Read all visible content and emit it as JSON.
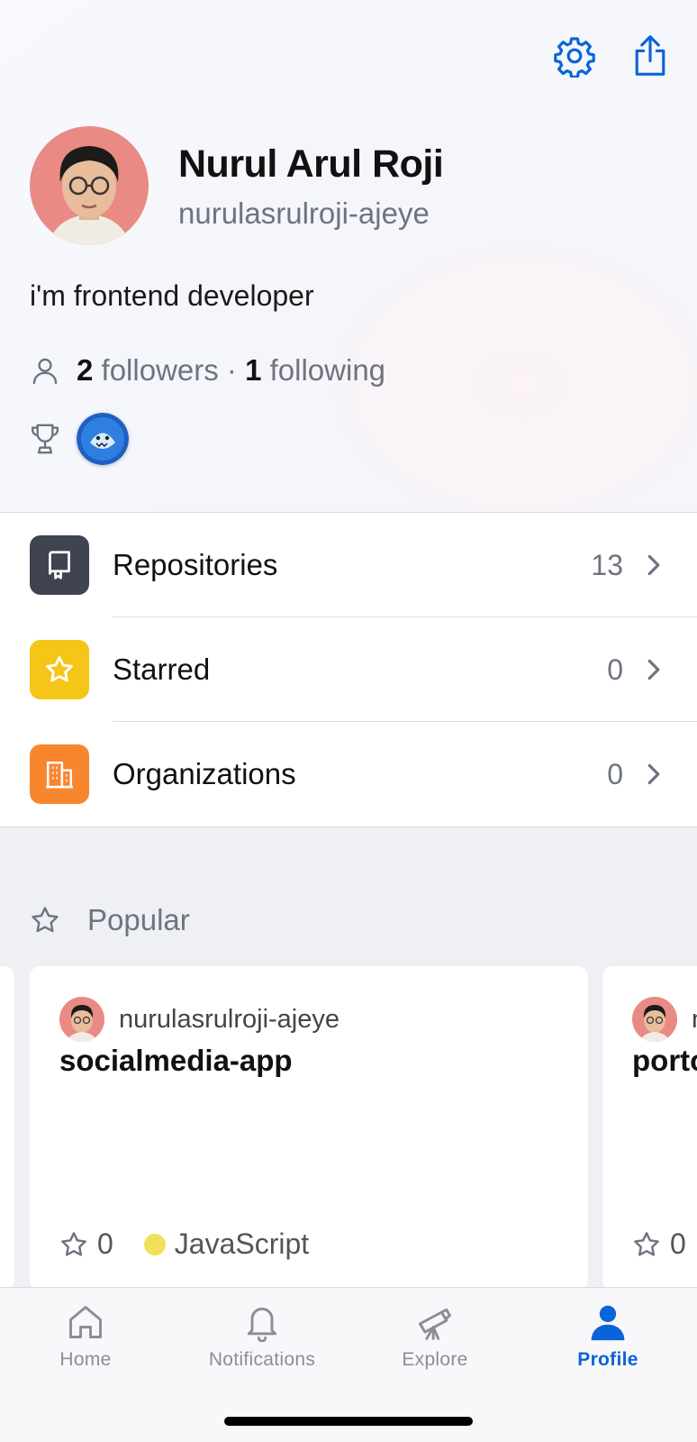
{
  "colors": {
    "accent": "#0a64d9",
    "repo_tile": "#3f4450",
    "starred_tile": "#f5c518",
    "org_tile": "#f7862e",
    "javascript": "#f1e05a"
  },
  "toolbar": {
    "settings_icon": "gear-icon",
    "share_icon": "share-icon"
  },
  "profile": {
    "name": "Nurul Arul Roji",
    "username": "nurulasrulroji-ajeye",
    "bio": "i'm frontend developer",
    "followers_count": "2",
    "followers_label": "followers",
    "separator": "·",
    "following_count": "1",
    "following_label": "following"
  },
  "menu": [
    {
      "label": "Repositories",
      "count": "13",
      "icon": "repo-icon"
    },
    {
      "label": "Starred",
      "count": "0",
      "icon": "star-icon"
    },
    {
      "label": "Organizations",
      "count": "0",
      "icon": "organization-icon"
    }
  ],
  "popular": {
    "title": "Popular",
    "cards": [
      {
        "owner": "nurulasrulroji-ajeye",
        "repo": "socialmedia-app",
        "stars": "0",
        "language": "JavaScript"
      },
      {
        "owner": "n",
        "repo": "porto",
        "stars": "0"
      }
    ]
  },
  "tabs": [
    {
      "label": "Home",
      "icon": "home-icon"
    },
    {
      "label": "Notifications",
      "icon": "bell-icon"
    },
    {
      "label": "Explore",
      "icon": "telescope-icon"
    },
    {
      "label": "Profile",
      "icon": "person-icon",
      "active": true
    }
  ]
}
